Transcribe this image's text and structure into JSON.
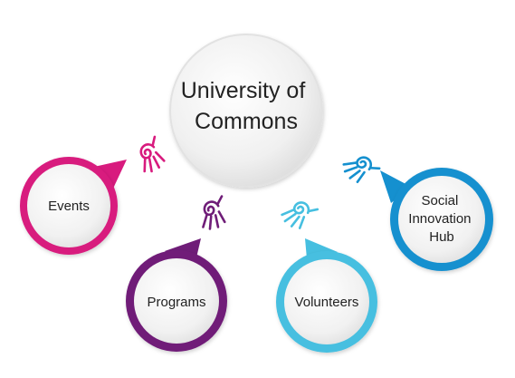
{
  "center": {
    "lines": [
      "University of",
      "Commons"
    ]
  },
  "nodes": [
    {
      "id": "events",
      "lines": [
        "Events"
      ],
      "color": "#d81b7e",
      "icon": "hand-spiral-icon"
    },
    {
      "id": "programs",
      "lines": [
        "Programs"
      ],
      "color": "#6f1d78",
      "icon": "hand-spiral-icon"
    },
    {
      "id": "volunteers",
      "lines": [
        "Volunteers"
      ],
      "color": "#46bfe0",
      "icon": "hand-spiral-icon"
    },
    {
      "id": "social-innovation-hub",
      "lines": [
        "Social",
        "Innovation",
        "Hub"
      ],
      "color": "#1590cf",
      "icon": "hand-spiral-icon"
    }
  ]
}
